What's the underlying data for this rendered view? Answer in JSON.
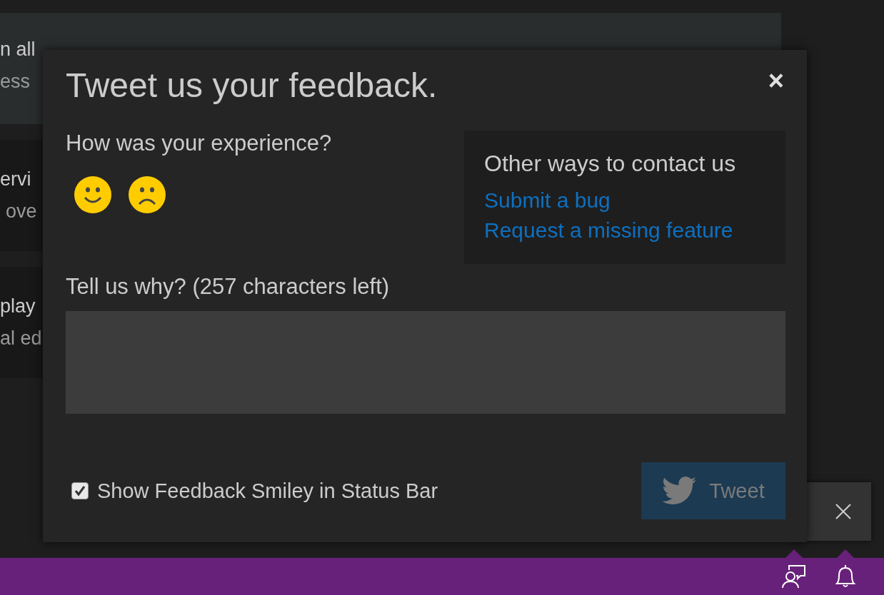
{
  "background_cards": [
    {
      "title": "n all",
      "subtitle": "ess"
    },
    {
      "title": "ervi",
      "subtitle": "ove"
    },
    {
      "title": "play",
      "subtitle": "al ed"
    }
  ],
  "dialog": {
    "title": "Tweet us your feedback.",
    "close": "×",
    "experience_label": "How was your experience?",
    "contact": {
      "title": "Other ways to contact us",
      "links": [
        "Submit a bug",
        "Request a missing feature"
      ]
    },
    "why_label": "Tell us why? (257 characters left)",
    "checkbox": {
      "label": "Show Feedback Smiley in Status Bar",
      "checked": true
    },
    "tweet_button": {
      "label": "Tweet",
      "disabled": true
    }
  },
  "status_bar": {
    "items": [
      {
        "kind": "feedback"
      },
      {
        "kind": "notifications"
      }
    ]
  }
}
